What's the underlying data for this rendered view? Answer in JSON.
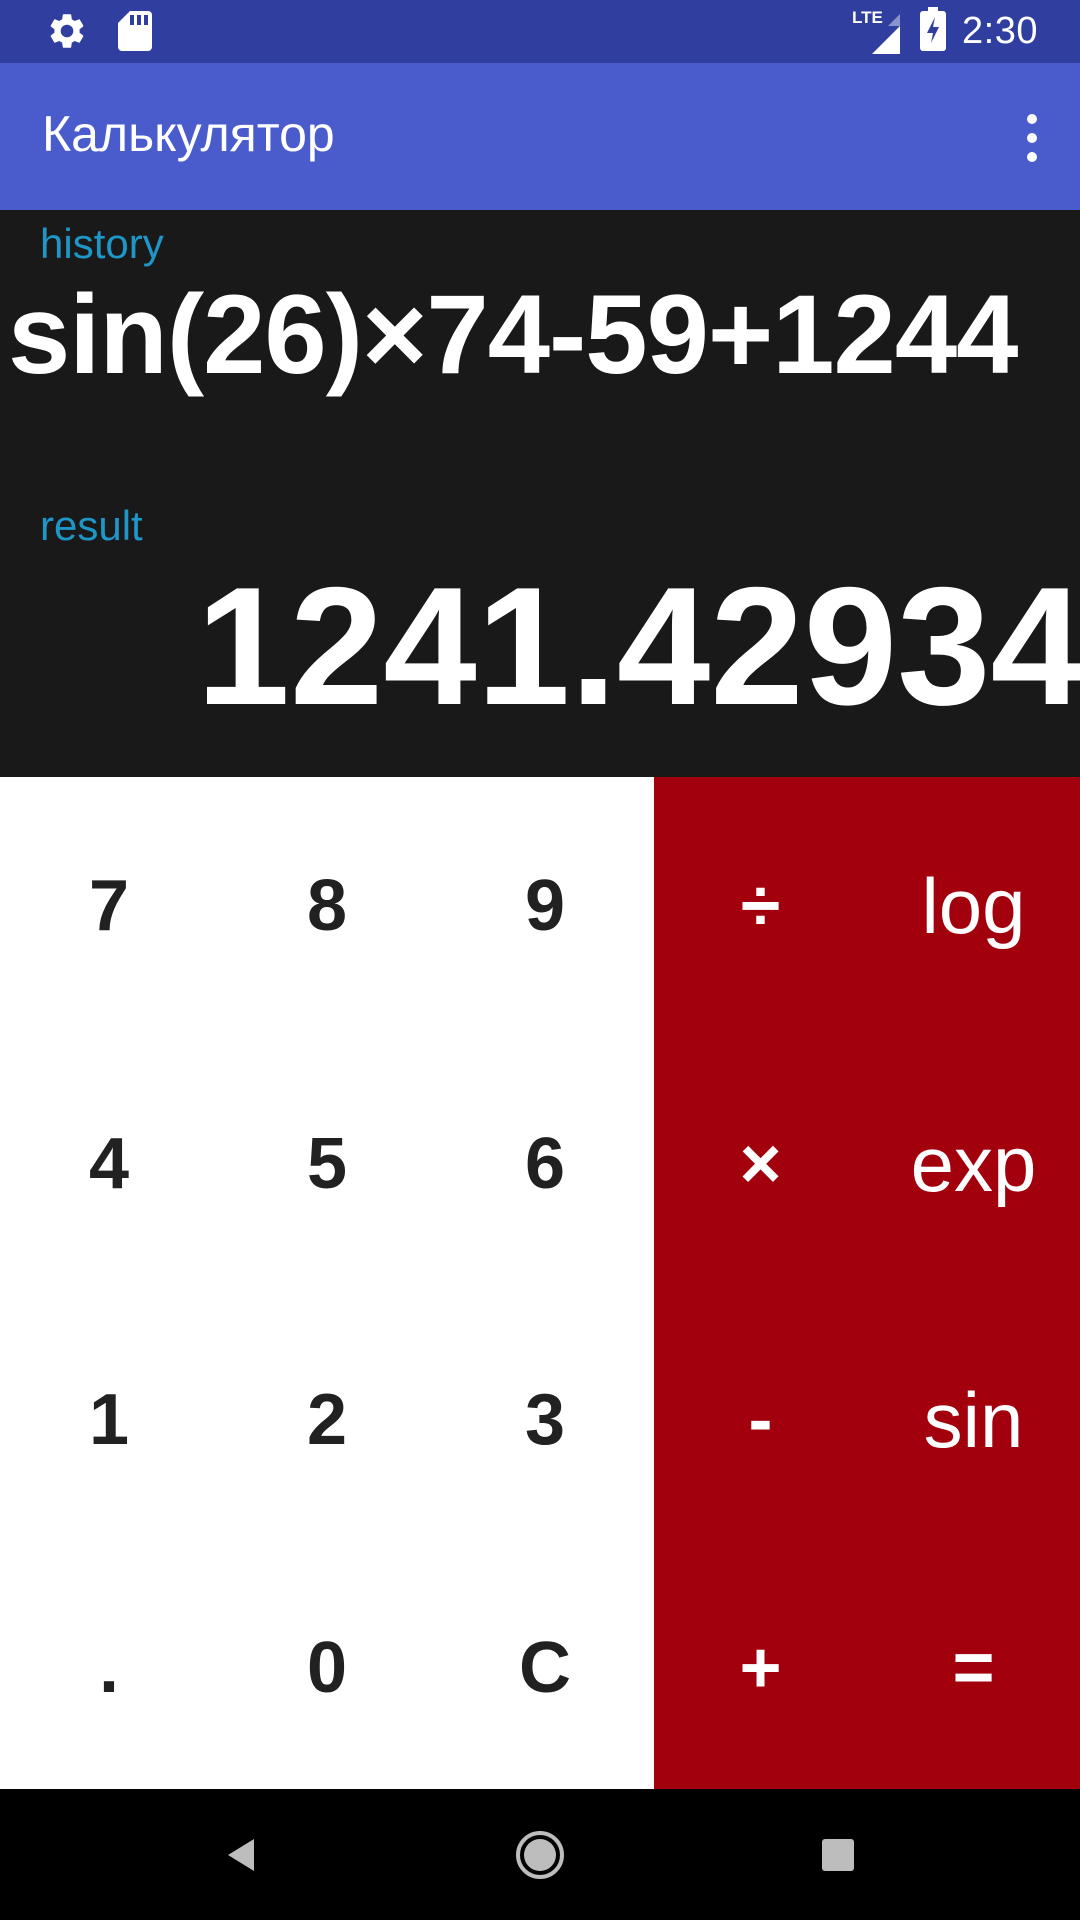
{
  "status_bar": {
    "time": "2:30",
    "network_label": "LTE",
    "icons": [
      "gear-icon",
      "sd-card-icon",
      "signal-icon",
      "battery-charging-icon"
    ]
  },
  "app_bar": {
    "title": "Калькулятор",
    "overflow_icon": "more-vert-icon"
  },
  "display": {
    "history_label": "history",
    "history_expression": "sin(26)×74-59+1244",
    "result_label": "result",
    "result_value": "1241.42934"
  },
  "keypad": {
    "digits": [
      [
        "7",
        "8",
        "9"
      ],
      [
        "4",
        "5",
        "6"
      ],
      [
        "1",
        "2",
        "3"
      ],
      [
        ".",
        "0",
        "C"
      ]
    ],
    "operators": [
      "÷",
      "×",
      "-",
      "+"
    ],
    "functions": [
      "log",
      "exp",
      "sin",
      "="
    ]
  },
  "nav_bar": {
    "icons": [
      "back-icon",
      "home-icon",
      "recents-icon"
    ]
  },
  "colors": {
    "status_bar": "#303f9f",
    "app_bar": "#4a5ccc",
    "display_bg": "#191919",
    "label_accent": "#1e96c8",
    "operator_panel": "#a2000c",
    "digit_panel": "#ffffff"
  }
}
